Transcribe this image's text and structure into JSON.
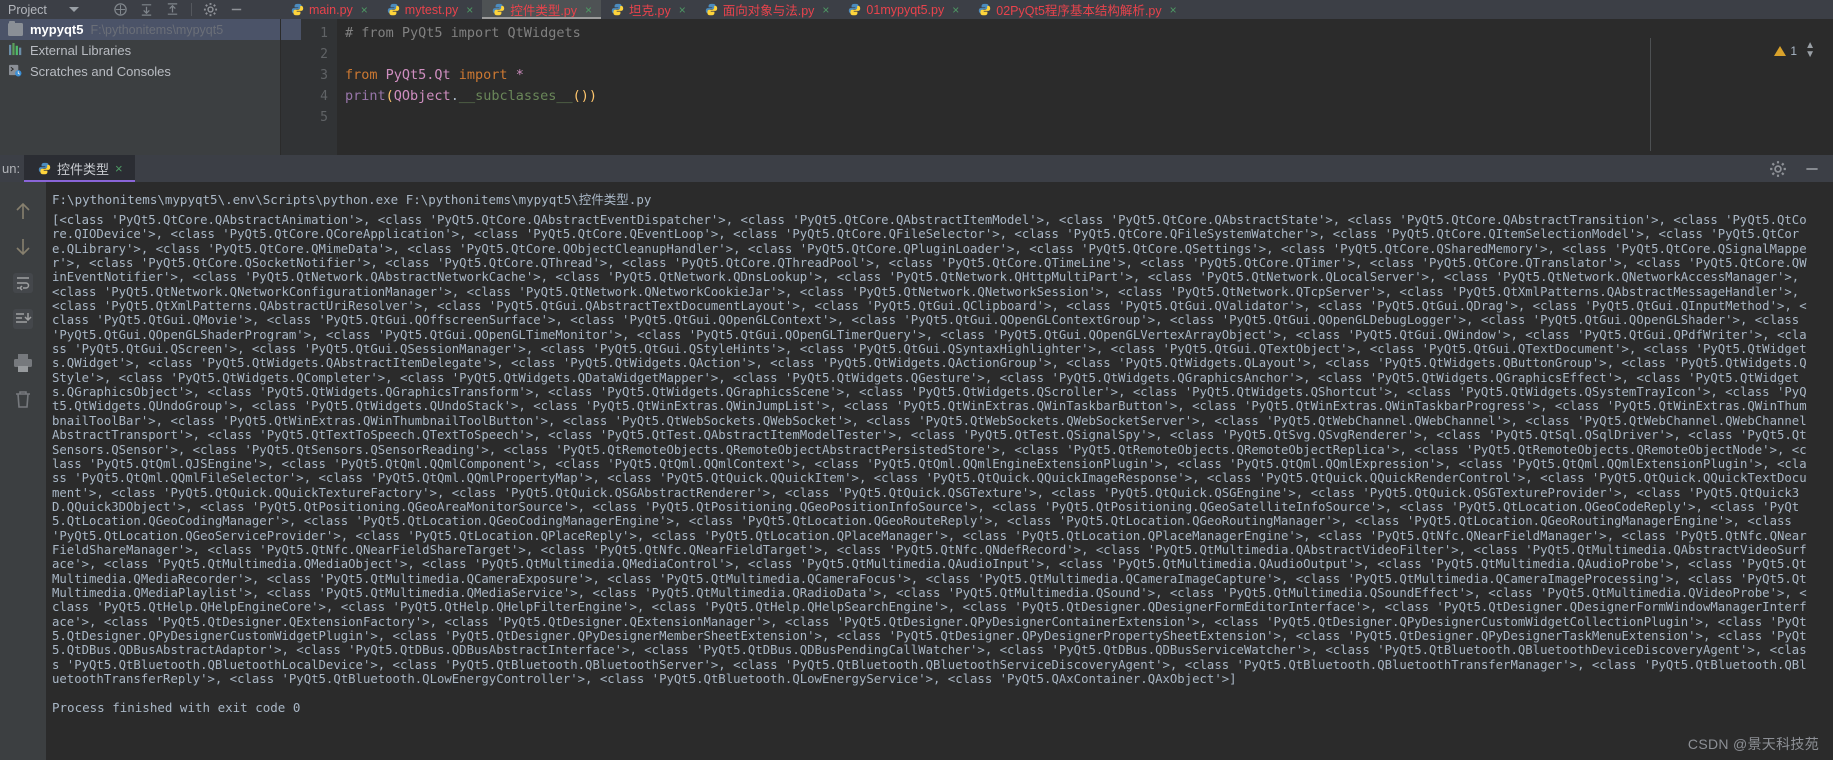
{
  "window": {
    "theme_bg": "#2b2b2b",
    "panel_bg": "#3c3f41",
    "accent_purple": "#8a65d8",
    "accent_red": "#e8434c",
    "accent_green": "#4e9a65"
  },
  "project_panel": {
    "title": "Project",
    "icons": [
      "collapse-all-icon",
      "expand-all-icon",
      "settings-icon",
      "hide-icon"
    ],
    "items": [
      {
        "label": "mypyqt5",
        "path": "F:\\pythonitems\\mypyqt5",
        "icon": "folder-icon",
        "selected": true
      },
      {
        "label": "External Libraries",
        "path": "",
        "icon": "libraries-icon",
        "selected": false
      },
      {
        "label": "Scratches and Consoles",
        "path": "",
        "icon": "scratches-icon",
        "selected": false
      }
    ]
  },
  "editor": {
    "tabs": [
      {
        "label": "main.py",
        "active": false
      },
      {
        "label": "mytest.py",
        "active": false
      },
      {
        "label": "控件类型.py",
        "active": true
      },
      {
        "label": "坦克.py",
        "active": false
      },
      {
        "label": "面向对象与法.py",
        "active": false
      },
      {
        "label": "01mypyqt5.py",
        "active": false
      },
      {
        "label": "02PyQt5程序基本结构解析.py",
        "active": false
      }
    ],
    "line_numbers": [
      "1",
      "2",
      "3",
      "4",
      "5"
    ],
    "code_lines": [
      {
        "n": "1",
        "tokens": [
          {
            "t": "# from PyQt5 import QtWidgets",
            "c": "k-comment"
          }
        ]
      },
      {
        "n": "2",
        "tokens": []
      },
      {
        "n": "3",
        "tokens": [
          {
            "t": "from ",
            "c": "k-kw"
          },
          {
            "t": "PyQt5.Qt ",
            "c": "k-pink"
          },
          {
            "t": "import ",
            "c": "k-kw"
          },
          {
            "t": "*",
            "c": "k-pink"
          }
        ]
      },
      {
        "n": "4",
        "tokens": [
          {
            "t": "print",
            "c": "k-magenta"
          },
          {
            "t": "(",
            "c": "k-prn-y"
          },
          {
            "t": "QObject",
            "c": "k-pink"
          },
          {
            "t": ".",
            "c": "k-call"
          },
          {
            "t": "__subclasses__",
            "c": "k-green"
          },
          {
            "t": "()",
            "c": "k-prn-y"
          },
          {
            "t": ")",
            "c": "k-prn-y"
          }
        ]
      },
      {
        "n": "5",
        "tokens": []
      }
    ],
    "inspection": {
      "warning_count": "1",
      "warning_icon": "warning-triangle-icon"
    }
  },
  "run_panel": {
    "label": "un:",
    "tab": {
      "label": "控件类型",
      "icon": "python-file-icon",
      "close": "×"
    },
    "toolbar_icons": [
      "scroll-up-icon",
      "scroll-down-icon",
      "soft-wrap-icon",
      "scroll-to-end-icon",
      "print-icon",
      "trash-icon"
    ],
    "settings_icon": "gear-icon",
    "minimize_icon": "minimize-icon",
    "command": "F:\\pythonitems\\mypyqt5\\.env\\Scripts\\python.exe F:\\pythonitems\\mypyqt5\\控件类型.py",
    "output": "[<class 'PyQt5.QtCore.QAbstractAnimation'>, <class 'PyQt5.QtCore.QAbstractEventDispatcher'>, <class 'PyQt5.QtCore.QAbstractItemModel'>, <class 'PyQt5.QtCore.QAbstractState'>, <class 'PyQt5.QtCore.QAbstractTransition'>, <class 'PyQt5.QtCore.QIODevice'>, <class 'PyQt5.QtCore.QCoreApplication'>, <class 'PyQt5.QtCore.QEventLoop'>, <class 'PyQt5.QtCore.QFileSelector'>, <class 'PyQt5.QtCore.QFileSystemWatcher'>, <class 'PyQt5.QtCore.QItemSelectionModel'>, <class 'PyQt5.QtCore.QLibrary'>, <class 'PyQt5.QtCore.QMimeData'>, <class 'PyQt5.QtCore.QObjectCleanupHandler'>, <class 'PyQt5.QtCore.QPluginLoader'>, <class 'PyQt5.QtCore.QSettings'>, <class 'PyQt5.QtCore.QSharedMemory'>, <class 'PyQt5.QtCore.QSignalMapper'>, <class 'PyQt5.QtCore.QSocketNotifier'>, <class 'PyQt5.QtCore.QThread'>, <class 'PyQt5.QtCore.QThreadPool'>, <class 'PyQt5.QtCore.QTimeLine'>, <class 'PyQt5.QtCore.QTimer'>, <class 'PyQt5.QtCore.QTranslator'>, <class 'PyQt5.QtCore.QWinEventNotifier'>, <class 'PyQt5.QtNetwork.QAbstractNetworkCache'>, <class 'PyQt5.QtNetwork.QDnsLookup'>, <class 'PyQt5.QtNetwork.QHttpMultiPart'>, <class 'PyQt5.QtNetwork.QLocalServer'>, <class 'PyQt5.QtNetwork.QNetworkAccessManager'>, <class 'PyQt5.QtNetwork.QNetworkConfigurationManager'>, <class 'PyQt5.QtNetwork.QNetworkCookieJar'>, <class 'PyQt5.QtNetwork.QNetworkSession'>, <class 'PyQt5.QtNetwork.QTcpServer'>, <class 'PyQt5.QtXmlPatterns.QAbstractMessageHandler'>, <class 'PyQt5.QtXmlPatterns.QAbstractUriResolver'>, <class 'PyQt5.QtGui.QAbstractTextDocumentLayout'>, <class 'PyQt5.QtGui.QClipboard'>, <class 'PyQt5.QtGui.QValidator'>, <class 'PyQt5.QtGui.QDrag'>, <class 'PyQt5.QtGui.QInputMethod'>, <class 'PyQt5.QtGui.QMovie'>, <class 'PyQt5.QtGui.QOffscreenSurface'>, <class 'PyQt5.QtGui.QOpenGLContext'>, <class 'PyQt5.QtGui.QOpenGLContextGroup'>, <class 'PyQt5.QtGui.QOpenGLDebugLogger'>, <class 'PyQt5.QtGui.QOpenGLShader'>, <class 'PyQt5.QtGui.QOpenGLShaderProgram'>, <class 'PyQt5.QtGui.QOpenGLTimeMonitor'>, <class 'PyQt5.QtGui.QOpenGLTimerQuery'>, <class 'PyQt5.QtGui.QOpenGLVertexArrayObject'>, <class 'PyQt5.QtGui.QWindow'>, <class 'PyQt5.QtGui.QPdfWriter'>, <class 'PyQt5.QtGui.QScreen'>, <class 'PyQt5.QtGui.QSessionManager'>, <class 'PyQt5.QtGui.QStyleHints'>, <class 'PyQt5.QtGui.QSyntaxHighlighter'>, <class 'PyQt5.QtGui.QTextObject'>, <class 'PyQt5.QtGui.QTextDocument'>, <class 'PyQt5.QtWidgets.QWidget'>, <class 'PyQt5.QtWidgets.QAbstractItemDelegate'>, <class 'PyQt5.QtWidgets.QAction'>, <class 'PyQt5.QtWidgets.QActionGroup'>, <class 'PyQt5.QtWidgets.QLayout'>, <class 'PyQt5.QtWidgets.QButtonGroup'>, <class 'PyQt5.QtWidgets.QStyle'>, <class 'PyQt5.QtWidgets.QCompleter'>, <class 'PyQt5.QtWidgets.QDataWidgetMapper'>, <class 'PyQt5.QtWidgets.QGesture'>, <class 'PyQt5.QtWidgets.QGraphicsAnchor'>, <class 'PyQt5.QtWidgets.QGraphicsEffect'>, <class 'PyQt5.QtWidgets.QGraphicsObject'>, <class 'PyQt5.QtWidgets.QGraphicsTransform'>, <class 'PyQt5.QtWidgets.QGraphicsScene'>, <class 'PyQt5.QtWidgets.QScroller'>, <class 'PyQt5.QtWidgets.QShortcut'>, <class 'PyQt5.QtWidgets.QSystemTrayIcon'>, <class 'PyQt5.QtWidgets.QUndoGroup'>, <class 'PyQt5.QtWidgets.QUndoStack'>, <class 'PyQt5.QtWinExtras.QWinJumpList'>, <class 'PyQt5.QtWinExtras.QWinTaskbarButton'>, <class 'PyQt5.QtWinExtras.QWinTaskbarProgress'>, <class 'PyQt5.QtWinExtras.QWinThumbnailToolBar'>, <class 'PyQt5.QtWinExtras.QWinThumbnailToolButton'>, <class 'PyQt5.QtWebSockets.QWebSocket'>, <class 'PyQt5.QtWebSockets.QWebSocketServer'>, <class 'PyQt5.QtWebChannel.QWebChannel'>, <class 'PyQt5.QtWebChannel.QWebChannelAbstractTransport'>, <class 'PyQt5.QtTextToSpeech.QTextToSpeech'>, <class 'PyQt5.QtTest.QAbstractItemModelTester'>, <class 'PyQt5.QtTest.QSignalSpy'>, <class 'PyQt5.QtSvg.QSvgRenderer'>, <class 'PyQt5.QtSql.QSqlDriver'>, <class 'PyQt5.QtSensors.QSensor'>, <class 'PyQt5.QtSensors.QSensorReading'>, <class 'PyQt5.QtRemoteObjects.QRemoteObjectAbstractPersistedStore'>, <class 'PyQt5.QtRemoteObjects.QRemoteObjectReplica'>, <class 'PyQt5.QtRemoteObjects.QRemoteObjectNode'>, <class 'PyQt5.QtQml.QJSEngine'>, <class 'PyQt5.QtQml.QQmlComponent'>, <class 'PyQt5.QtQml.QQmlContext'>, <class 'PyQt5.QtQml.QQmlEngineExtensionPlugin'>, <class 'PyQt5.QtQml.QQmlExpression'>, <class 'PyQt5.QtQml.QQmlExtensionPlugin'>, <class 'PyQt5.QtQml.QQmlFileSelector'>, <class 'PyQt5.QtQml.QQmlPropertyMap'>, <class 'PyQt5.QtQuick.QQuickItem'>, <class 'PyQt5.QtQuick.QQuickImageResponse'>, <class 'PyQt5.QtQuick.QQuickRenderControl'>, <class 'PyQt5.QtQuick.QQuickTextDocument'>, <class 'PyQt5.QtQuick.QQuickTextureFactory'>, <class 'PyQt5.QtQuick.QSGAbstractRenderer'>, <class 'PyQt5.QtQuick.QSGTexture'>, <class 'PyQt5.QtQuick.QSGEngine'>, <class 'PyQt5.QtQuick.QSGTextureProvider'>, <class 'PyQt5.QtQuick3D.QQuick3DObject'>, <class 'PyQt5.QtPositioning.QGeoAreaMonitorSource'>, <class 'PyQt5.QtPositioning.QGeoPositionInfoSource'>, <class 'PyQt5.QtPositioning.QGeoSatelliteInfoSource'>, <class 'PyQt5.QtLocation.QGeoCodeReply'>, <class 'PyQt5.QtLocation.QGeoCodingManager'>, <class 'PyQt5.QtLocation.QGeoCodingManagerEngine'>, <class 'PyQt5.QtLocation.QGeoRouteReply'>, <class 'PyQt5.QtLocation.QGeoRoutingManager'>, <class 'PyQt5.QtLocation.QGeoRoutingManagerEngine'>, <class 'PyQt5.QtLocation.QGeoServiceProvider'>, <class 'PyQt5.QtLocation.QPlaceReply'>, <class 'PyQt5.QtLocation.QPlaceManager'>, <class 'PyQt5.QtLocation.QPlaceManagerEngine'>, <class 'PyQt5.QtNfc.QNearFieldManager'>, <class 'PyQt5.QtNfc.QNearFieldShareManager'>, <class 'PyQt5.QtNfc.QNearFieldShareTarget'>, <class 'PyQt5.QtNfc.QNearFieldTarget'>, <class 'PyQt5.QtNfc.QNdefRecord'>, <class 'PyQt5.QtMultimedia.QAbstractVideoFilter'>, <class 'PyQt5.QtMultimedia.QAbstractVideoSurface'>, <class 'PyQt5.QtMultimedia.QMediaObject'>, <class 'PyQt5.QtMultimedia.QMediaControl'>, <class 'PyQt5.QtMultimedia.QAudioInput'>, <class 'PyQt5.QtMultimedia.QAudioOutput'>, <class 'PyQt5.QtMultimedia.QAudioProbe'>, <class 'PyQt5.QtMultimedia.QMediaRecorder'>, <class 'PyQt5.QtMultimedia.QCameraExposure'>, <class 'PyQt5.QtMultimedia.QCameraFocus'>, <class 'PyQt5.QtMultimedia.QCameraImageCapture'>, <class 'PyQt5.QtMultimedia.QCameraImageProcessing'>, <class 'PyQt5.QtMultimedia.QMediaPlaylist'>, <class 'PyQt5.QtMultimedia.QMediaService'>, <class 'PyQt5.QtMultimedia.QRadioData'>, <class 'PyQt5.QtMultimedia.QSound'>, <class 'PyQt5.QtMultimedia.QSoundEffect'>, <class 'PyQt5.QtMultimedia.QVideoProbe'>, <class 'PyQt5.QtHelp.QHelpEngineCore'>, <class 'PyQt5.QtHelp.QHelpFilterEngine'>, <class 'PyQt5.QtHelp.QHelpSearchEngine'>, <class 'PyQt5.QtDesigner.QDesignerFormEditorInterface'>, <class 'PyQt5.QtDesigner.QDesignerFormWindowManagerInterface'>, <class 'PyQt5.QtDesigner.QExtensionFactory'>, <class 'PyQt5.QtDesigner.QExtensionManager'>, <class 'PyQt5.QtDesigner.QPyDesignerContainerExtension'>, <class 'PyQt5.QtDesigner.QPyDesignerCustomWidgetCollectionPlugin'>, <class 'PyQt5.QtDesigner.QPyDesignerCustomWidgetPlugin'>, <class 'PyQt5.QtDesigner.QPyDesignerMemberSheetExtension'>, <class 'PyQt5.QtDesigner.QPyDesignerPropertySheetExtension'>, <class 'PyQt5.QtDesigner.QPyDesignerTaskMenuExtension'>, <class 'PyQt5.QtDBus.QDBusAbstractAdaptor'>, <class 'PyQt5.QtDBus.QDBusAbstractInterface'>, <class 'PyQt5.QtDBus.QDBusPendingCallWatcher'>, <class 'PyQt5.QtDBus.QDBusServiceWatcher'>, <class 'PyQt5.QtBluetooth.QBluetoothDeviceDiscoveryAgent'>, <class 'PyQt5.QtBluetooth.QBluetoothLocalDevice'>, <class 'PyQt5.QtBluetooth.QBluetoothServer'>, <class 'PyQt5.QtBluetooth.QBluetoothServiceDiscoveryAgent'>, <class 'PyQt5.QtBluetooth.QBluetoothTransferManager'>, <class 'PyQt5.QtBluetooth.QBluetoothTransferReply'>, <class 'PyQt5.QtBluetooth.QLowEnergyController'>, <class 'PyQt5.QtBluetooth.QLowEnergyService'>, <class 'PyQt5.QAxContainer.QAxObject'>]",
    "finished": "Process finished with exit code 0"
  },
  "watermark": "CSDN @景天科技苑"
}
